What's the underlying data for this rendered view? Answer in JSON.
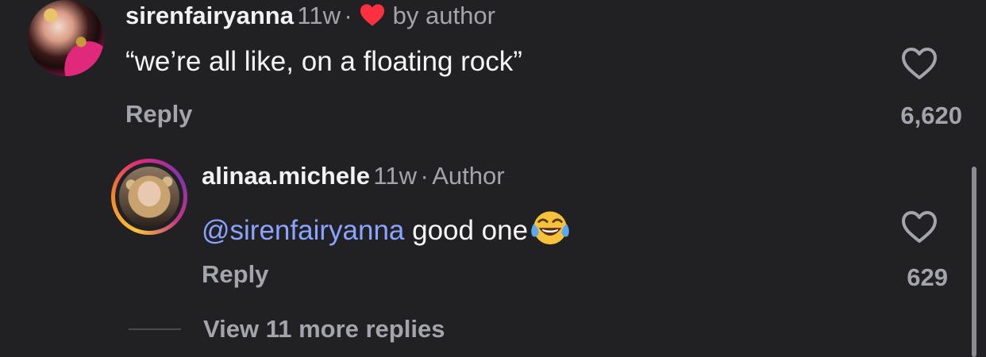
{
  "comment": {
    "username": "sirenfairyanna",
    "time": "11w",
    "separator": "·",
    "liked_by": "by author",
    "text": "“we’re all like, on a floating rock”",
    "reply_label": "Reply",
    "like_count": "6,620"
  },
  "reply": {
    "username": "alinaa.michele",
    "time": "11w",
    "separator": "·",
    "badge": "Author",
    "mention": "@sirenfairyanna",
    "text": " good one",
    "emoji": "face-with-tears-of-joy",
    "reply_label": "Reply",
    "like_count": "629"
  },
  "thread": {
    "view_more_label": "View 11 more replies"
  },
  "colors": {
    "background": "#212124",
    "secondary_text": "#a4a4ab",
    "mention": "#8aa4ff",
    "liked_heart": "#ff3040"
  },
  "icons": {
    "like": "heart-outline-icon",
    "liked_by_author": "heart-filled-icon"
  }
}
